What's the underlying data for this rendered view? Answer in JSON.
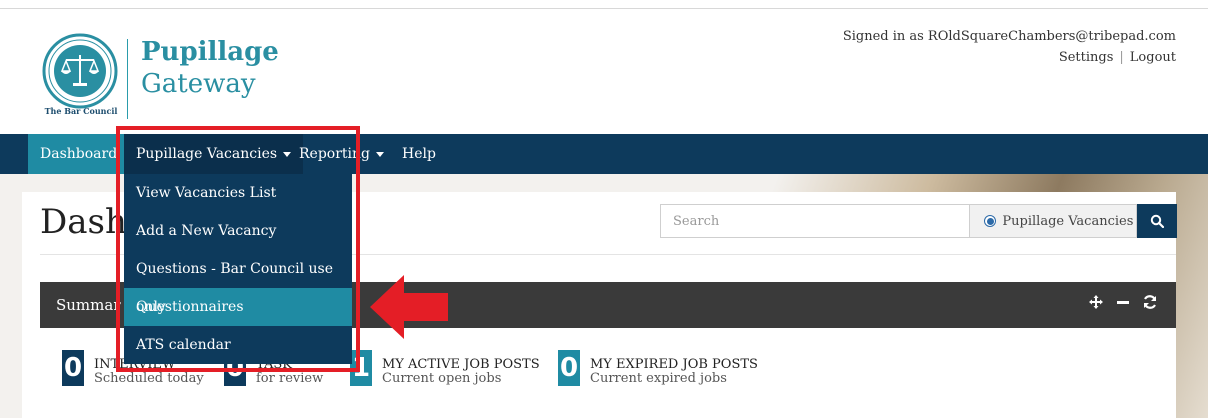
{
  "header": {
    "logo_caption": "The Bar Council",
    "logo_seal_text": "THE GENERAL COUNCIL OF THE BAR · JUSTICE FOR ALL",
    "brand_line1": "Pupillage",
    "brand_line2": "Gateway",
    "signed_in_text": "Signed in as ROldSquareChambers@tribepad.com",
    "settings_label": "Settings",
    "separator": "|",
    "logout_label": "Logout"
  },
  "nav": {
    "items": [
      {
        "label": "Dashboard",
        "active": true
      },
      {
        "label": "Pupillage Vacancies",
        "open": true
      },
      {
        "label": "Reporting"
      },
      {
        "label": "Help"
      }
    ]
  },
  "dropdown": {
    "items": [
      {
        "label": "View Vacancies List"
      },
      {
        "label": "Add a New Vacancy"
      },
      {
        "label": "Questions - Bar Council use only"
      },
      {
        "label": "Questionnaires",
        "highlighted": true
      },
      {
        "label": "ATS calendar"
      }
    ]
  },
  "main": {
    "page_title": "Dashb",
    "search": {
      "placeholder": "Search",
      "radio_label": "Pupillage Vacancies",
      "radio_checked": true
    },
    "summary_title": "Summar",
    "stats": [
      {
        "value": "0",
        "label": "INTERVIEW",
        "sub": "Scheduled today"
      },
      {
        "value": "0",
        "label": "TASK",
        "sub": "for review"
      },
      {
        "value": "1",
        "label": "MY ACTIVE JOB POSTS",
        "sub": "Current open jobs"
      },
      {
        "value": "0",
        "label": "MY EXPIRED JOB POSTS",
        "sub": "Current expired jobs"
      }
    ]
  },
  "colors": {
    "navbar": "#0d3a5c",
    "accent_teal": "#1f8ba3",
    "brand": "#2a8fa2",
    "annotation_red": "#e41e26",
    "summary_bar": "#3a3a3a"
  },
  "icons": [
    "bar-council-seal-icon",
    "caret-down-icon",
    "search-icon",
    "move-icon",
    "minimize-icon",
    "refresh-icon",
    "red-arrow-icon"
  ]
}
